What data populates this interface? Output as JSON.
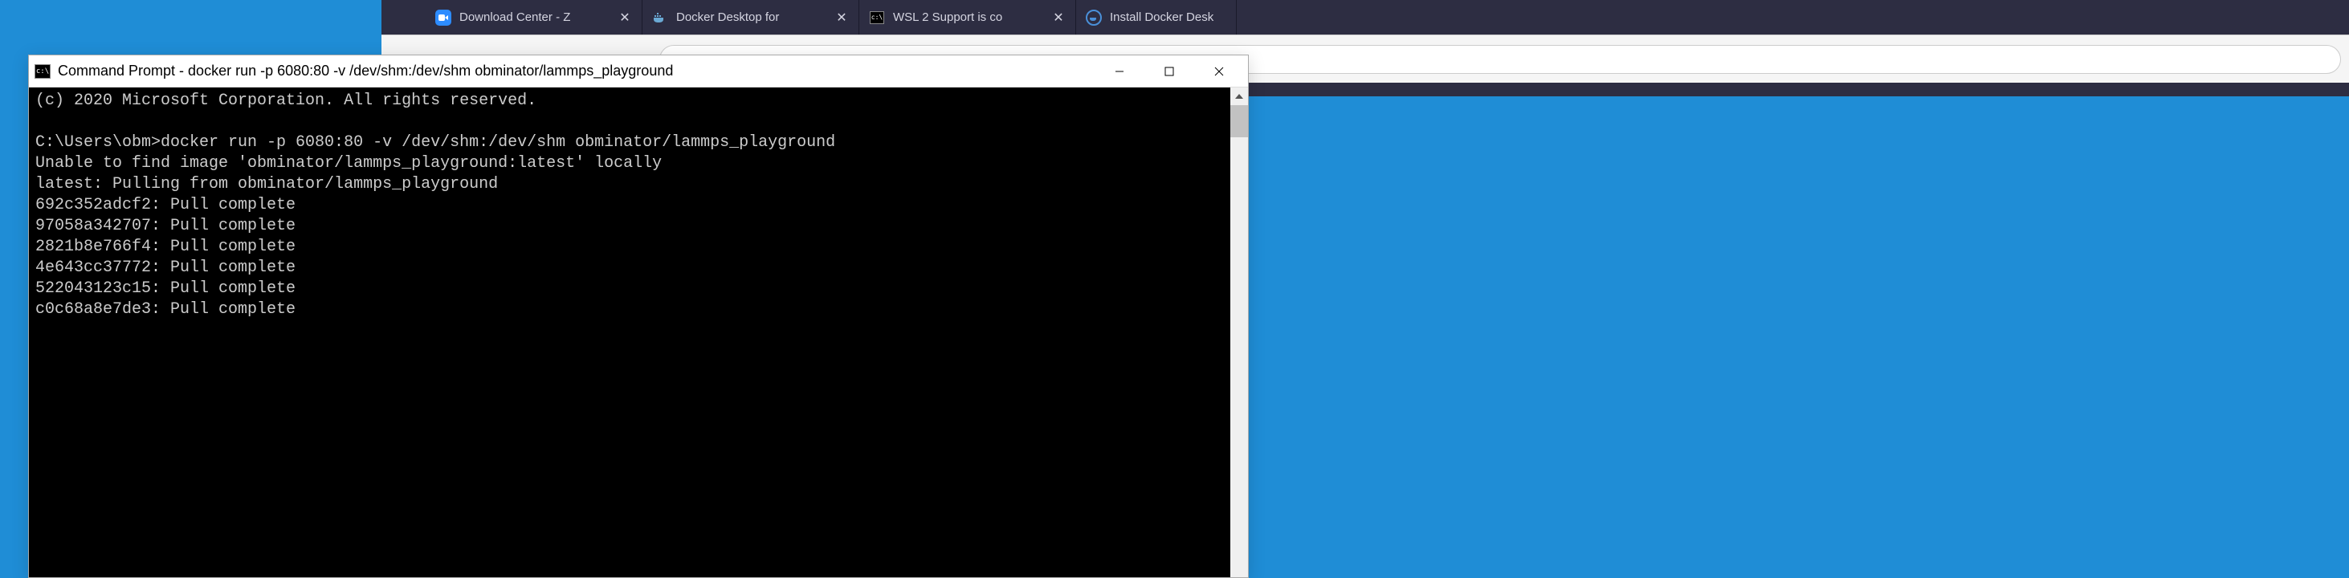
{
  "browser": {
    "tabs": [
      {
        "label": "Download Center - Z",
        "icon": "zoom"
      },
      {
        "label": "Docker Desktop for",
        "icon": "docker"
      },
      {
        "label": "WSL 2 Support is co",
        "icon": "cmd"
      },
      {
        "label": "Install Docker Desk",
        "icon": "docker-circle"
      }
    ]
  },
  "cmdWindow": {
    "title": "Command Prompt - docker  run -p 6080:80 -v /dev/shm:/dev/shm obminator/lammps_playground",
    "lines": {
      "copyright": "(c) 2020 Microsoft Corporation. All rights reserved.",
      "blank1": "",
      "prompt": "C:\\Users\\obm>docker run -p 6080:80 -v /dev/shm:/dev/shm obminator/lammps_playground",
      "unable": "Unable to find image 'obminator/lammps_playground:latest' locally",
      "pulling": "latest: Pulling from obminator/lammps_playground",
      "layer1": "692c352adcf2: Pull complete",
      "layer2": "97058a342707: Pull complete",
      "layer3": "2821b8e766f4: Pull complete",
      "layer4": "4e643cc37772: Pull complete",
      "layer5": "522043123c15: Pull complete",
      "layer6": "c0c68a8e7de3: Pull complete"
    }
  }
}
